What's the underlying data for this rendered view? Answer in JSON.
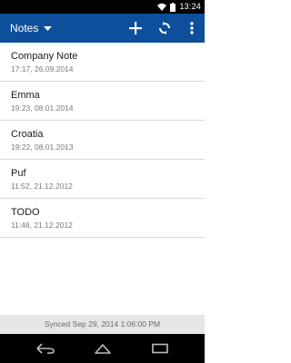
{
  "status_bar": {
    "time": "13:24",
    "icons": [
      "wifi-icon",
      "battery-icon"
    ]
  },
  "app_bar": {
    "title": "Notes",
    "actions": [
      "add-icon",
      "sync-icon",
      "overflow-menu-icon"
    ]
  },
  "notes": [
    {
      "title": "Company Note",
      "date": "17:17, 26.09.2014"
    },
    {
      "title": "Emma",
      "date": "19:23, 08.01.2014"
    },
    {
      "title": "Croatia",
      "date": "19:22, 08.01.2013"
    },
    {
      "title": "Puf",
      "date": "11:52, 21.12.2012"
    },
    {
      "title": "TODO",
      "date": "11:48, 21.12.2012"
    }
  ],
  "sync_status": "Synced Sep 29, 2014 1:06:00 PM",
  "nav_bar": {
    "buttons": [
      "back-icon",
      "home-icon",
      "recents-icon"
    ]
  },
  "colors": {
    "app_bar": "#0d4f9a",
    "sync_bar": "#e6e6e6"
  }
}
